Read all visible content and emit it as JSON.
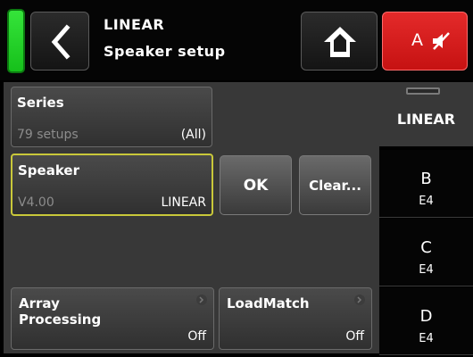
{
  "header": {
    "title": "LINEAR",
    "subtitle": "Speaker setup",
    "channel_button": {
      "label": "A",
      "icon": "speaker-mute-icon",
      "color": "#d81b1b"
    },
    "level_meter_color": "#22cc22",
    "back_icon": "chevron-left-icon",
    "home_icon": "home-icon"
  },
  "series": {
    "label": "Series",
    "sub": "79 setups",
    "value": "(All)"
  },
  "speaker": {
    "label": "Speaker",
    "sub": "V4.00",
    "value": "LINEAR",
    "highlight_color": "#c9c83a"
  },
  "buttons": {
    "ok": "OK",
    "clear": "Clear..."
  },
  "tiles": {
    "array": {
      "label_line1": "Array",
      "label_line2": "Processing",
      "value": "Off"
    },
    "loadmatch": {
      "label": "LoadMatch",
      "value": "Off"
    }
  },
  "channels": {
    "selected": "LINEAR",
    "items": [
      {
        "letter": "B",
        "type": "E4"
      },
      {
        "letter": "C",
        "type": "E4"
      },
      {
        "letter": "D",
        "type": "E4"
      }
    ]
  }
}
